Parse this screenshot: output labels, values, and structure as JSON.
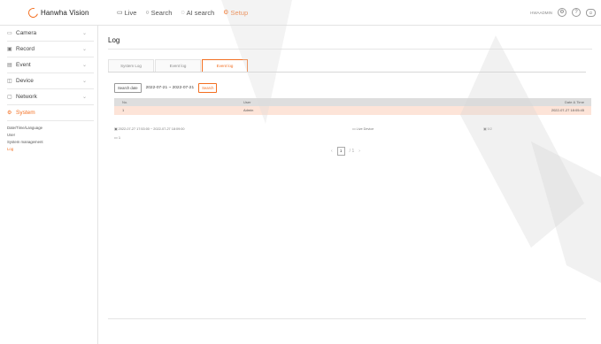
{
  "header": {
    "brand": "Hanwha Vision",
    "nav": [
      {
        "icon": "monitor-icon",
        "label": "Live",
        "active": false
      },
      {
        "icon": "search-icon",
        "label": "Search",
        "active": false
      },
      {
        "icon": "ai-search-icon",
        "label": "AI search",
        "active": false
      },
      {
        "icon": "gear-icon",
        "label": "Setup",
        "active": true
      }
    ],
    "user": "HWAADMIN",
    "accent_color": "#f36f21"
  },
  "sidebar": {
    "items": [
      {
        "icon": "camera-icon",
        "label": "Camera"
      },
      {
        "icon": "record-icon",
        "label": "Record"
      },
      {
        "icon": "event-icon",
        "label": "Event"
      },
      {
        "icon": "device-icon",
        "label": "Device"
      },
      {
        "icon": "network-icon",
        "label": "Network"
      },
      {
        "icon": "system-icon",
        "label": "System",
        "active": true
      }
    ],
    "submenu": [
      "Date/Time/Language",
      "User",
      "System management",
      "Log"
    ],
    "active_sub": "Log"
  },
  "main": {
    "title": "Log",
    "tabs": [
      {
        "label": "System Log",
        "active": false
      },
      {
        "label": "Event log",
        "active": false
      },
      {
        "label": "Event log",
        "active": true
      }
    ],
    "search_date_button": "Search date",
    "date_range": "2022-07-21 ~ 2022-07-21",
    "search_button": "Search",
    "table": {
      "headers": [
        "No.",
        "User",
        "Date & Time"
      ],
      "rows": [
        {
          "no": "1",
          "user": "Admin",
          "datetime": "2022-07-27 18:05:45"
        }
      ]
    },
    "detail": {
      "range": "2022-07-27 17:53:00 ~ 2022-07-27 18:09:00",
      "type": "Live Device",
      "channel": "5/2"
    },
    "count": "1",
    "pagination": {
      "prev": "‹",
      "current": "1",
      "total": "/ 1",
      "next": "›"
    }
  }
}
